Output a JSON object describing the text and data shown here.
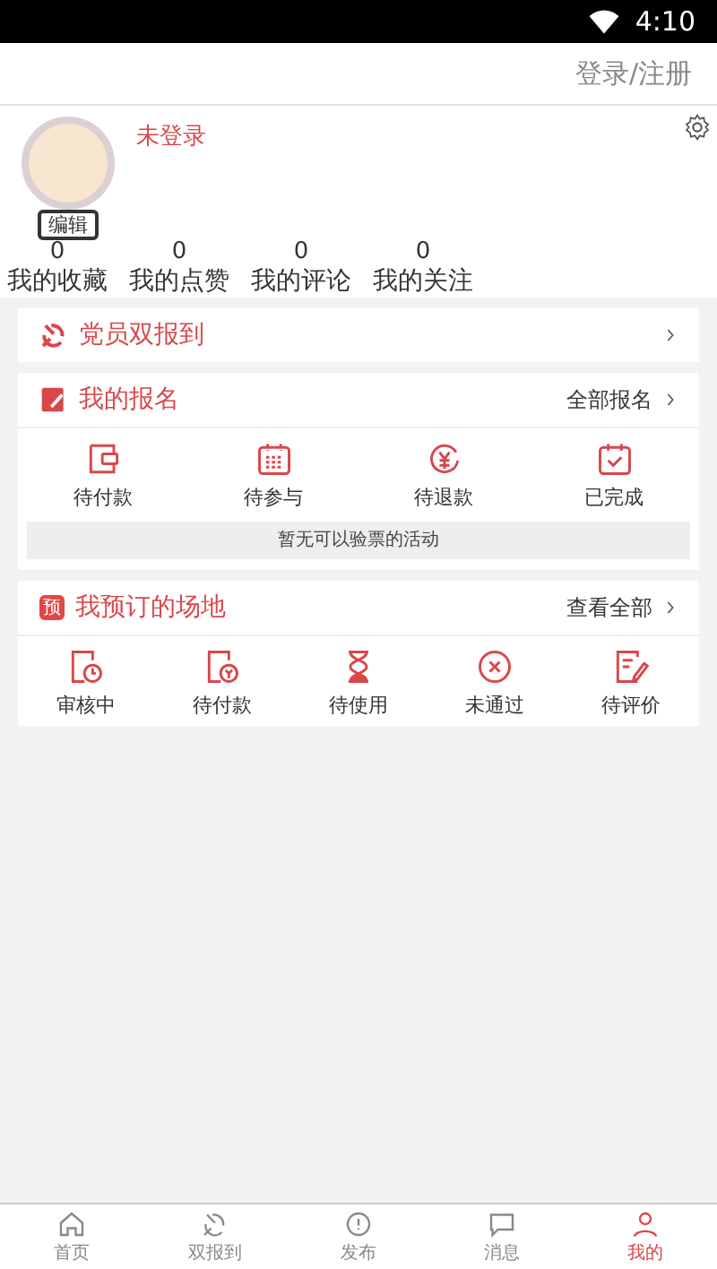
{
  "status_bar": {
    "time": "4:10"
  },
  "header": {
    "login_link": "登录/注册"
  },
  "profile": {
    "name": "未登录",
    "edit_label": "编辑",
    "stats": [
      {
        "count": "0",
        "label": "我的收藏"
      },
      {
        "count": "0",
        "label": "我的点赞"
      },
      {
        "count": "0",
        "label": "我的评论"
      },
      {
        "count": "0",
        "label": "我的关注"
      }
    ]
  },
  "party_checkin": {
    "title": "党员双报到"
  },
  "registrations": {
    "title": "我的报名",
    "more": "全部报名",
    "items": [
      {
        "kind": "wallet",
        "label": "待付款"
      },
      {
        "kind": "calendar",
        "label": "待参与"
      },
      {
        "kind": "refund",
        "label": "待退款"
      },
      {
        "kind": "done",
        "label": "已完成"
      }
    ],
    "notice": "暂无可以验票的活动"
  },
  "venues": {
    "title": "我预订的场地",
    "badge": "预",
    "more": "查看全部",
    "items": [
      {
        "kind": "review",
        "label": "审核中"
      },
      {
        "kind": "pay",
        "label": "待付款"
      },
      {
        "kind": "hourglass",
        "label": "待使用"
      },
      {
        "kind": "rejected",
        "label": "未通过"
      },
      {
        "kind": "rate",
        "label": "待评价"
      }
    ]
  },
  "tab_bar": [
    {
      "kind": "home",
      "label": "首页",
      "selected": false
    },
    {
      "kind": "party",
      "label": "双报到",
      "selected": false
    },
    {
      "kind": "publish",
      "label": "发布",
      "selected": false
    },
    {
      "kind": "message",
      "label": "消息",
      "selected": false
    },
    {
      "kind": "me",
      "label": "我的",
      "selected": true
    }
  ]
}
